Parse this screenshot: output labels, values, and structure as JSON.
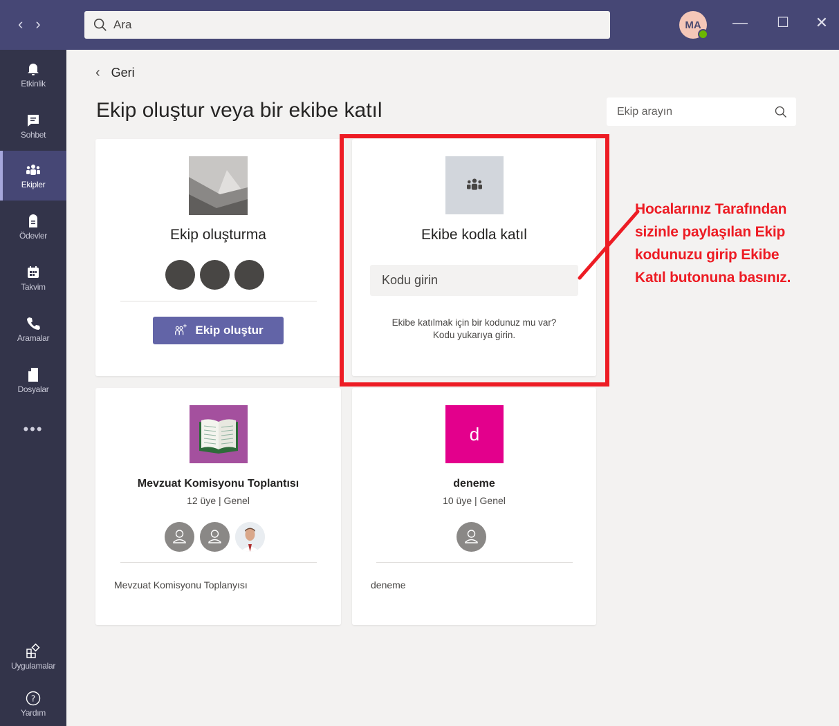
{
  "titlebar": {
    "back_arrow": "‹",
    "forward_arrow": "›",
    "search_placeholder": "Ara",
    "avatar_initials": "MA",
    "minimize": "—",
    "maximize": "☐",
    "close": "✕"
  },
  "rail": {
    "items": [
      {
        "label": "Etkinlik",
        "icon": "bell-icon"
      },
      {
        "label": "Sohbet",
        "icon": "chat-icon"
      },
      {
        "label": "Ekipler",
        "icon": "teams-icon",
        "active": true
      },
      {
        "label": "Ödevler",
        "icon": "assignments-icon"
      },
      {
        "label": "Takvim",
        "icon": "calendar-icon"
      },
      {
        "label": "Aramalar",
        "icon": "phone-icon"
      },
      {
        "label": "Dosyalar",
        "icon": "file-icon"
      }
    ],
    "more": "•••",
    "apps_label": "Uygulamalar",
    "help_label": "Yardım"
  },
  "main": {
    "back_label": "Geri",
    "title": "Ekip oluştur veya bir ekibe katıl",
    "team_search_placeholder": "Ekip arayın"
  },
  "create_card": {
    "title": "Ekip oluşturma",
    "button_label": "Ekip oluştur"
  },
  "join_card": {
    "title": "Ekibe kodla katıl",
    "input_placeholder": "Kodu girin",
    "hint_line1": "Ekibe katılmak için bir kodunuz mu var?",
    "hint_line2": "Kodu yukarıya girin."
  },
  "teams": [
    {
      "name": "Mevzuat Komisyonu Toplantısı",
      "meta": "12 üye | Genel",
      "description": "Mevzuat Komisyonu Toplanyısı",
      "tile_color": "#a4509e"
    },
    {
      "name": "deneme",
      "meta": "10 üye | Genel",
      "description": "deneme",
      "tile_letter": "d",
      "tile_color": "#e3008c"
    }
  ],
  "annotation": {
    "line1": "Hocalarınız Tarafından",
    "line2": "sizinle paylaşılan Ekip",
    "line3": "kodunuzu girip Ekibe",
    "line4": "Katıl butonuna basınız.",
    "color": "#ed1c24"
  }
}
